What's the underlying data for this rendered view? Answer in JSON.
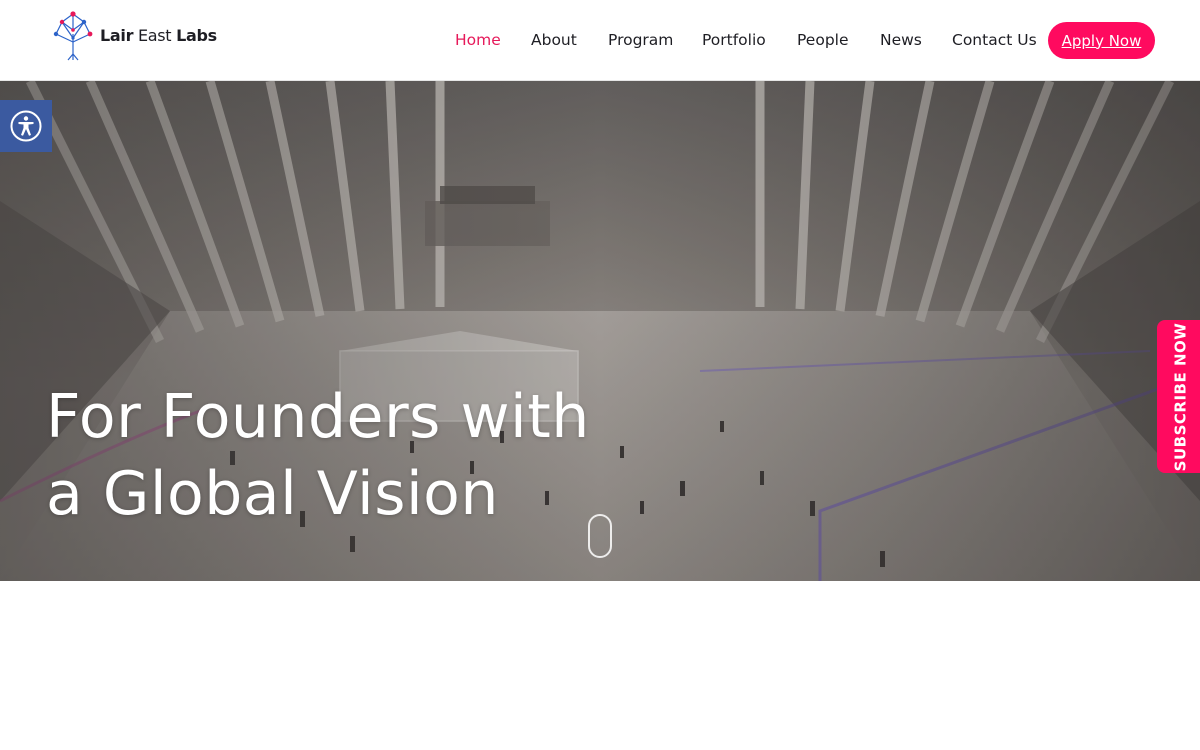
{
  "brand": {
    "name_part1": "Lair",
    "name_part2": " East ",
    "name_part3": "Labs",
    "logo_icon": "tree-network-logo"
  },
  "nav": {
    "items": [
      {
        "label": "Home",
        "active": true
      },
      {
        "label": "About",
        "active": false
      },
      {
        "label": "Program",
        "active": false
      },
      {
        "label": "Portfolio",
        "active": false
      },
      {
        "label": "People",
        "active": false
      },
      {
        "label": "News",
        "active": false
      },
      {
        "label": "Contact Us",
        "active": false
      }
    ],
    "cta_label": "Apply Now"
  },
  "hero": {
    "title_line1": "For Founders with",
    "title_line2": "a Global Vision"
  },
  "accessibility": {
    "icon": "accessibility-icon"
  },
  "subscribe": {
    "label": "SUBSCRIBE NOW"
  },
  "colors": {
    "accent": "#ff0a5f",
    "nav_active": "#e6195a",
    "accessibility_bg": "#3b5aa0"
  }
}
